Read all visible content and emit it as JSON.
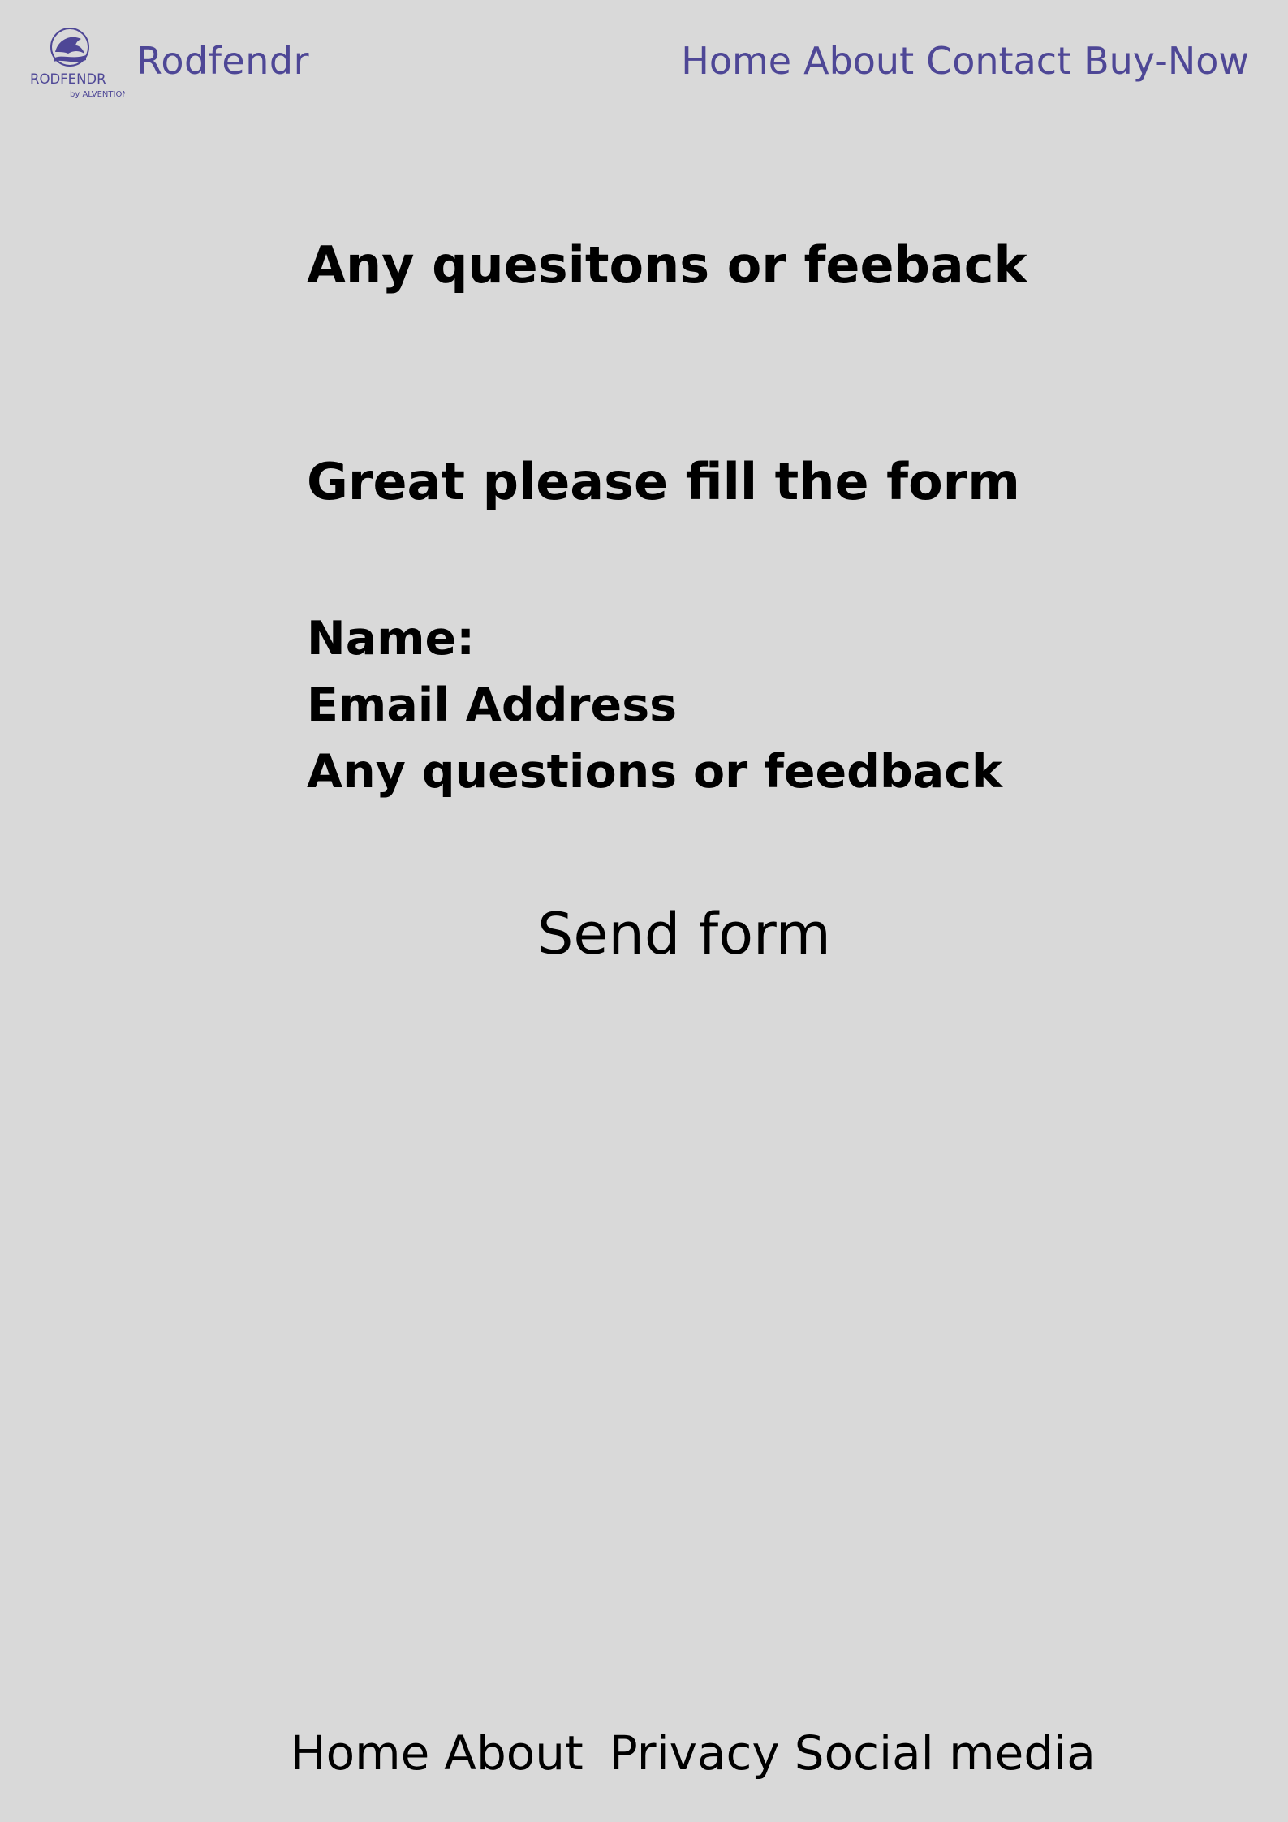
{
  "header": {
    "logo_text": "RODFENDR",
    "logo_subtext": "by ALVENTION",
    "brand_name": "Rodfendr",
    "nav": [
      "Home",
      "About",
      "Contact",
      "Buy-Now"
    ]
  },
  "main": {
    "heading_1": "Any quesitons or feeback",
    "heading_2": "Great please fill the form",
    "fields": [
      "Name:",
      "Email Address",
      "Any questions or feedback"
    ],
    "send_button": "Send form"
  },
  "footer": {
    "nav": [
      "Home",
      "About",
      "Privacy",
      "Social media"
    ]
  },
  "colors": {
    "background": "#d9d9d9",
    "brand": "#4e4796",
    "text": "#000000"
  }
}
